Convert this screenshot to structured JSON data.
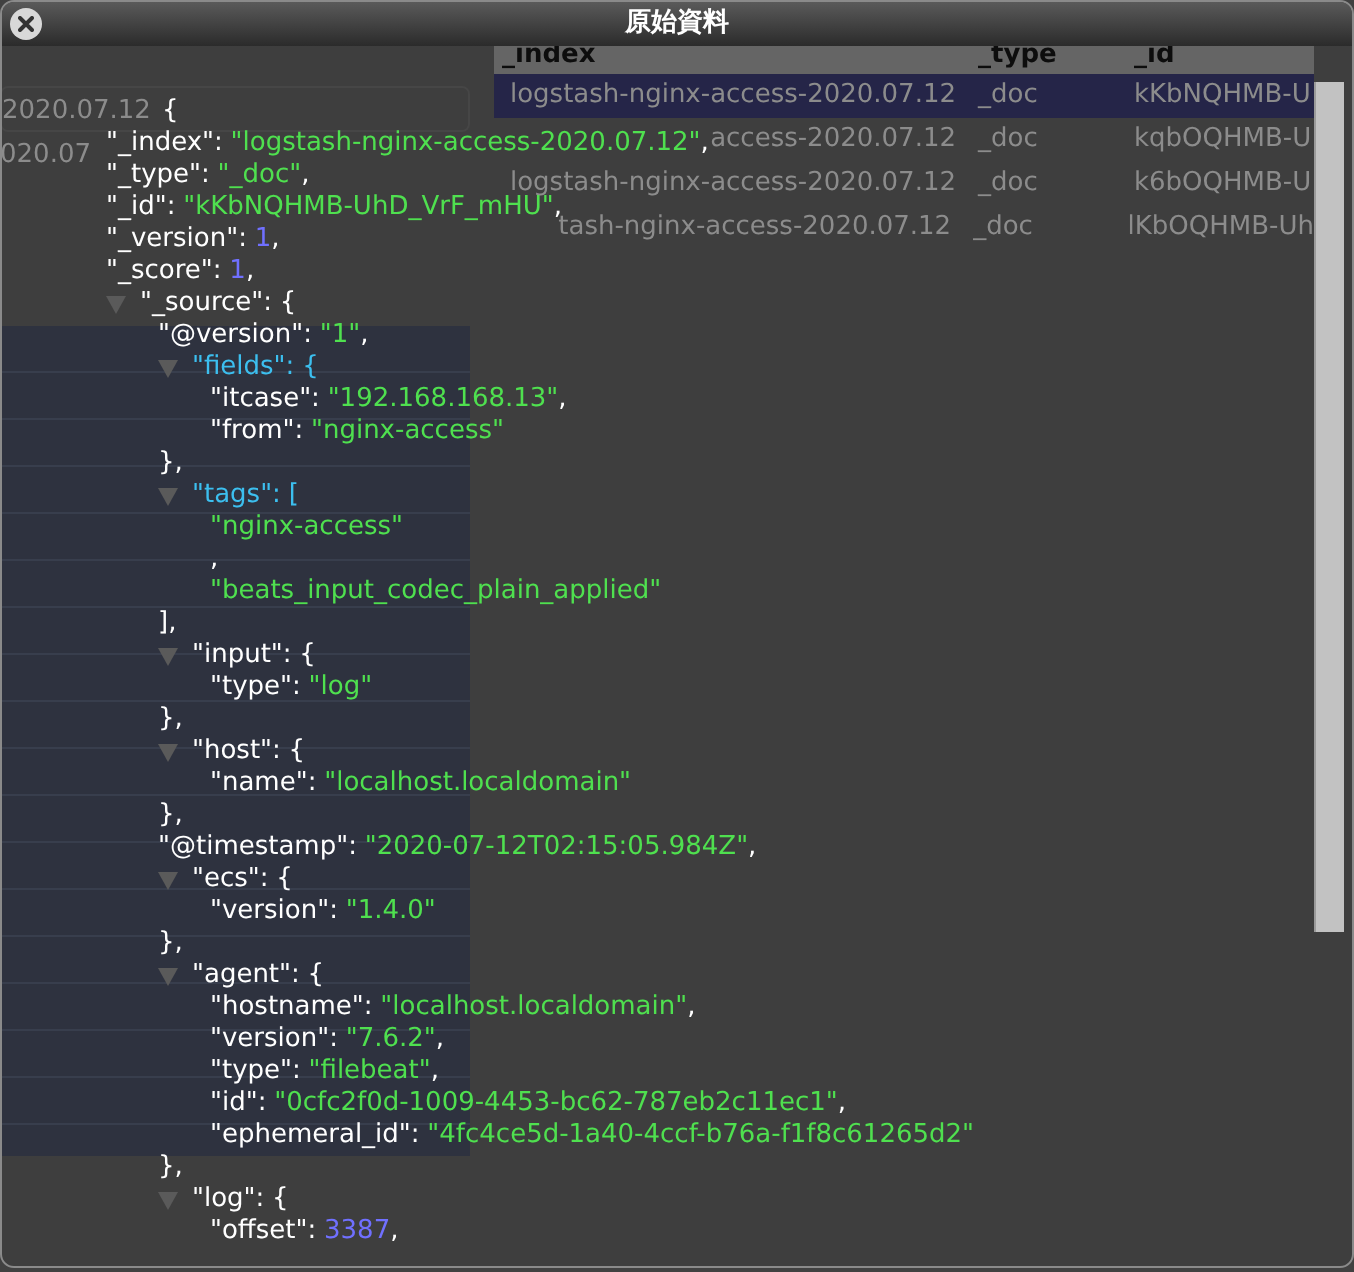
{
  "background_page": {
    "index_list": [
      "2020.07.12",
      "020.07"
    ],
    "results_table": {
      "columns": [
        "_index",
        "_type",
        "_id"
      ],
      "rows": [
        {
          "cells": [
            "logstash-nginx-access-2020.07.12",
            "_doc",
            "kKbNQHMB-U"
          ],
          "selected": true
        },
        {
          "cells": [
            "access-2020.07.12",
            "_doc",
            "kqbOQHMB-U"
          ],
          "selected": false
        },
        {
          "cells": [
            "logstash-nginx-access-2020.07.12",
            "_doc",
            "k6bOQHMB-U"
          ],
          "selected": false
        },
        {
          "cells": [
            "tash-nginx-access-2020.07.12",
            "_doc",
            "lKbOQHMB-Uh"
          ],
          "selected": false
        }
      ]
    }
  },
  "dialog": {
    "title": "原始資料",
    "document": {
      "open": "{",
      "children": [
        {
          "kind": "string",
          "key": "\"_index\":",
          "value": "\"logstash-nginx-access-2020.07.12\"",
          "comma": ","
        },
        {
          "kind": "string",
          "key": "\"_type\":",
          "value": "\"_doc\"",
          "comma": ","
        },
        {
          "kind": "string",
          "key": "\"_id\":",
          "value": "\"kKbNQHMB-UhD_VrF_mHU\"",
          "comma": ","
        },
        {
          "kind": "number",
          "key": "\"_version\":",
          "value": "1",
          "comma": ","
        },
        {
          "kind": "number",
          "key": "\"_score\":",
          "value": "1",
          "comma": ","
        },
        {
          "kind": "object",
          "key": "\"_source\":",
          "open": "{",
          "expanded": true,
          "highlighted": false,
          "children": [
            {
              "kind": "string",
              "key": "\"@version\":",
              "value": "\"1\"",
              "comma": ","
            },
            {
              "kind": "object",
              "key": "\"fields\":",
              "open": "{",
              "expanded": true,
              "highlighted": true,
              "children": [
                {
                  "kind": "string",
                  "key": "\"itcase\":",
                  "value": "\"192.168.168.13\"",
                  "comma": ","
                },
                {
                  "kind": "string",
                  "key": "\"from\":",
                  "value": "\"nginx-access\""
                }
              ],
              "close": "},"
            },
            {
              "kind": "object",
              "key": "\"tags\":",
              "open": "[",
              "expanded": true,
              "highlighted": true,
              "children": [
                {
                  "kind": "string",
                  "value": "\"nginx-access\""
                },
                {
                  "kind": "separator",
                  "value": ","
                },
                {
                  "kind": "string",
                  "value": "\"beats_input_codec_plain_applied\""
                }
              ],
              "close": "],"
            },
            {
              "kind": "object",
              "key": "\"input\":",
              "open": "{",
              "expanded": true,
              "highlighted": false,
              "children": [
                {
                  "kind": "string",
                  "key": "\"type\":",
                  "value": "\"log\""
                }
              ],
              "close": "},"
            },
            {
              "kind": "object",
              "key": "\"host\":",
              "open": "{",
              "expanded": true,
              "highlighted": false,
              "children": [
                {
                  "kind": "string",
                  "key": "\"name\":",
                  "value": "\"localhost.localdomain\""
                }
              ],
              "close": "},"
            },
            {
              "kind": "string",
              "key": "\"@timestamp\":",
              "value": "\"2020-07-12T02:15:05.984Z\"",
              "comma": ","
            },
            {
              "kind": "object",
              "key": "\"ecs\":",
              "open": "{",
              "expanded": true,
              "highlighted": false,
              "children": [
                {
                  "kind": "string",
                  "key": "\"version\":",
                  "value": "\"1.4.0\""
                }
              ],
              "close": "},"
            },
            {
              "kind": "object",
              "key": "\"agent\":",
              "open": "{",
              "expanded": true,
              "highlighted": false,
              "children": [
                {
                  "kind": "string",
                  "key": "\"hostname\":",
                  "value": "\"localhost.localdomain\"",
                  "comma": ","
                },
                {
                  "kind": "string",
                  "key": "\"version\":",
                  "value": "\"7.6.2\"",
                  "comma": ","
                },
                {
                  "kind": "string",
                  "key": "\"type\":",
                  "value": "\"filebeat\"",
                  "comma": ","
                },
                {
                  "kind": "string",
                  "key": "\"id\":",
                  "value": "\"0cfc2f0d-1009-4453-bc62-787eb2c11ec1\"",
                  "comma": ","
                },
                {
                  "kind": "string",
                  "key": "\"ephemeral_id\":",
                  "value": "\"4fc4ce5d-1a40-4ccf-b76a-f1f8c61265d2\""
                }
              ],
              "close": "},"
            },
            {
              "kind": "object",
              "key": "\"log\":",
              "open": "{",
              "expanded": true,
              "highlighted": false,
              "children": [
                {
                  "kind": "number",
                  "key": "\"offset\":",
                  "value": "3387",
                  "comma": ","
                }
              ]
            }
          ]
        }
      ]
    }
  }
}
